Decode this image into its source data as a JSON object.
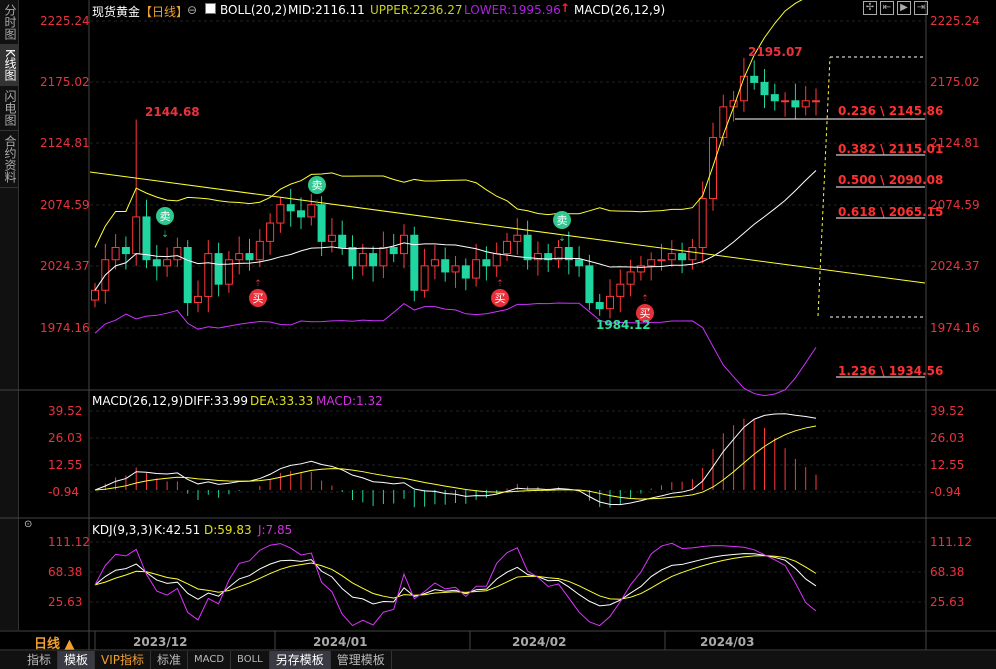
{
  "sidebar": {
    "tabs": [
      "分时图",
      "K线图",
      "闪电图",
      "合约资料"
    ]
  },
  "header": {
    "title": "现货黄金",
    "period": "【日线】",
    "boll": "BOLL(20,2)",
    "mid": "MID:2116.11",
    "upper": "UPPER:2236.27",
    "lower": "LOWER:1995.96",
    "macd": "MACD(26,12,9)"
  },
  "price_axis": [
    "2225.24",
    "2175.02",
    "2124.81",
    "2074.59",
    "2024.37",
    "1974.16"
  ],
  "annotations": {
    "high": "2144.68",
    "low": "1984.12",
    "peak": "2195.07"
  },
  "signals": {
    "sell": "卖",
    "buy": "买"
  },
  "fib": [
    "0.236 \\ 2145.86",
    "0.382 \\ 2115.01",
    "0.500 \\ 2090.08",
    "0.618 \\ 2065.15",
    "1.236 \\ 1934.56"
  ],
  "macd_panel": {
    "title": "MACD(26,12,9)",
    "diff": "DIFF:33.99",
    "dea": "DEA:33.33",
    "macd": "MACD:1.32",
    "axis": [
      "39.52",
      "26.03",
      "12.55",
      "-0.94"
    ]
  },
  "kdj_panel": {
    "title": "KDJ(9,3,3)",
    "k": "K:42.51",
    "d": "D:59.83",
    "j": "J:7.85",
    "axis": [
      "111.12",
      "68.38",
      "25.63"
    ]
  },
  "dates": [
    "2023/12",
    "2024/01",
    "2024/02",
    "2024/03"
  ],
  "period_selector": "日线 ▲",
  "bottom_tabs": [
    "指标",
    "模板",
    "VIP指标",
    "标准",
    "MACD",
    "BOLL",
    "另存模板",
    "管理模板"
  ],
  "colors": {
    "up": "#ff3838",
    "down": "#1fd6a0",
    "boll_mid": "#ffffff",
    "boll_band": "#ffff33",
    "lower": "#cc33ff"
  },
  "chart_data": {
    "type": "candlestick",
    "closes": [
      2005,
      2030,
      2040,
      2035,
      2065,
      2030,
      2025,
      2030,
      2040,
      1995,
      2000,
      2035,
      2010,
      2030,
      2035,
      2030,
      2045,
      2060,
      2075,
      2070,
      2065,
      2075,
      2045,
      2050,
      2040,
      2025,
      2035,
      2025,
      2040,
      2035,
      2050,
      2005,
      2025,
      2030,
      2020,
      2025,
      2015,
      2030,
      2025,
      2035,
      2045,
      2050,
      2030,
      2035,
      2030,
      2040,
      2030,
      2025,
      1995,
      1990,
      2000,
      2010,
      2020,
      2025,
      2030,
      2030,
      2035,
      2030,
      2040,
      2080,
      2130,
      2155,
      2160,
      2180,
      2175,
      2165,
      2160,
      2160,
      2155,
      2160,
      2160
    ]
  }
}
